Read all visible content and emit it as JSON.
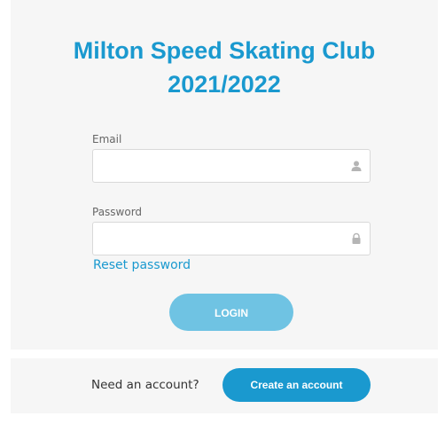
{
  "header": {
    "title_line1": "Milton Speed Skating Club",
    "title_line2": "2021/2022"
  },
  "form": {
    "email_label": "Email",
    "email_value": "",
    "email_icon": "user-icon",
    "password_label": "Password",
    "password_value": "",
    "password_icon": "lock-icon",
    "reset_link": "Reset password",
    "login_label": "LOGIN"
  },
  "footer": {
    "need_account_text": "Need an account?",
    "create_account_label": "Create an account"
  },
  "colors": {
    "accent": "#1a99cf",
    "login_button": "#6fc3e3",
    "panel_background": "#f6f6f6"
  }
}
